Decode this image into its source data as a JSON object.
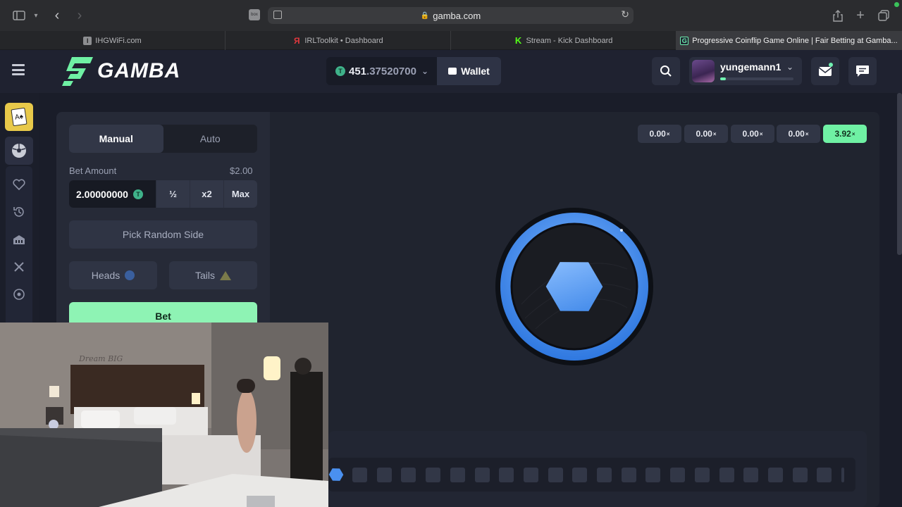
{
  "browser": {
    "url": "gamba.com",
    "site_favicon_text": "box",
    "tabs": [
      {
        "label": "IHGWiFi.com",
        "favicon": "I",
        "color": "#8d8e91"
      },
      {
        "label": "IRLToolkit • Dashboard",
        "favicon": "Я",
        "color": "#e0383e"
      },
      {
        "label": "Stream - Kick Dashboard",
        "favicon": "K",
        "color": "#53fc18"
      },
      {
        "label": "Progressive Coinflip Game Online | Fair Betting at Gamba...",
        "favicon": "G",
        "color": "#6ff1b0",
        "active": true
      }
    ]
  },
  "header": {
    "logo": "GAMBA",
    "balance_whole": "451",
    "balance_frac": ".37520700",
    "wallet_label": "Wallet",
    "username": "yungemann1",
    "xp_progress_pct": 8
  },
  "controls": {
    "mode_manual": "Manual",
    "mode_auto": "Auto",
    "bet_amount_label": "Bet Amount",
    "bet_amount_usd": "$2.00",
    "bet_amount_value": "2.00000000",
    "half_label": "½",
    "double_label": "x2",
    "max_label": "Max",
    "pick_random_label": "Pick Random Side",
    "heads_label": "Heads",
    "tails_label": "Tails",
    "bet_button_label": "Bet"
  },
  "multipliers": [
    {
      "value": "0.00",
      "suffix": "×"
    },
    {
      "value": "0.00",
      "suffix": "×"
    },
    {
      "value": "0.00",
      "suffix": "×"
    },
    {
      "value": "0.00",
      "suffix": "×"
    },
    {
      "value": "3.92",
      "suffix": "×",
      "win": true
    }
  ],
  "colors": {
    "accent_green": "#6ff1a4",
    "coin_blue": "#3f8df0"
  },
  "webcam": {
    "wall_text_1": "Dream BIG"
  }
}
